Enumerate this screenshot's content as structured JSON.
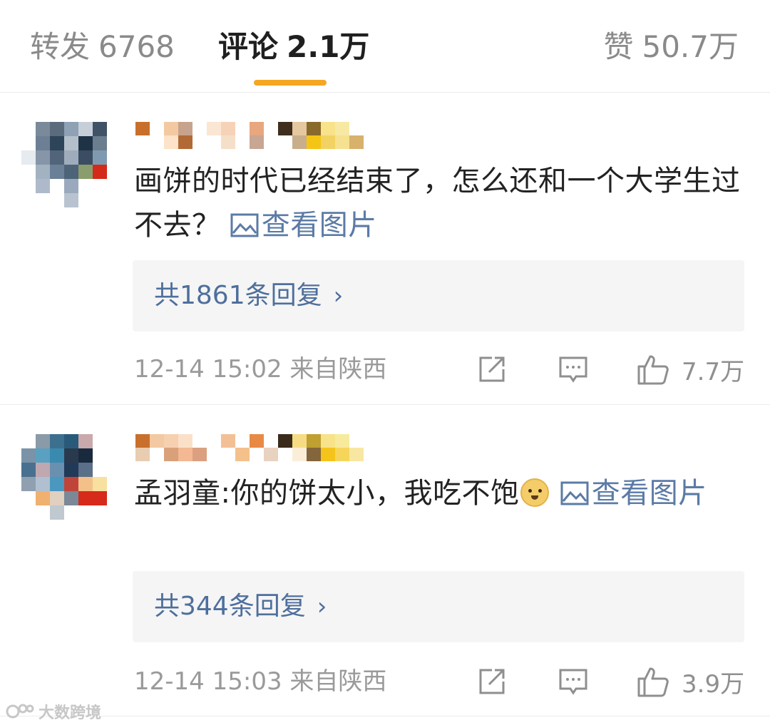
{
  "tabs": {
    "repost": {
      "label": "转发",
      "count": "6768"
    },
    "comments": {
      "label": "评论",
      "count": "2.1万"
    },
    "likes": {
      "label": "赞",
      "count": "50.7万"
    },
    "active_color": "#f5a623"
  },
  "comments": [
    {
      "text": "画饼的时代已经结束了，怎么还和一个大学生过不去？",
      "view_image": "查看图片",
      "replies": "共1861条回复",
      "meta": "12-14 15:02 来自陕西",
      "likes": "7.7万"
    },
    {
      "text": "孟羽童:你的饼太小，我吃不饱",
      "emoji": "doge-emoji",
      "view_image": "查看图片",
      "replies": "共344条回复",
      "meta": "12-14 15:03 来自陕西",
      "likes": "3.9万"
    }
  ],
  "icons": {
    "share": "share-icon",
    "comment": "comment-icon",
    "like": "thumbs-up-icon",
    "image": "image-icon",
    "chevron": "chevron-right-icon"
  },
  "colors": {
    "link": "#4e6f9c",
    "meta": "#9a9a9a",
    "reply_bg": "#f5f5f5"
  },
  "watermark": "大数跨境"
}
